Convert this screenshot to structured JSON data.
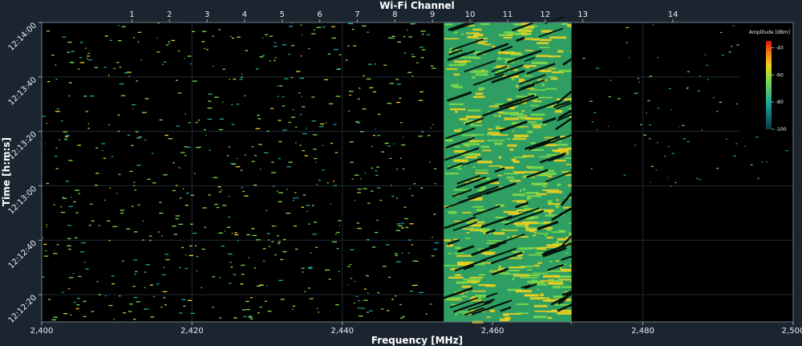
{
  "chart_data": {
    "type": "heatmap",
    "title": "Wi-Fi Channel",
    "xlabel": "Frequency [MHz]",
    "ylabel": "Time [h:m:s]",
    "xlim": [
      2400,
      2500
    ],
    "x_ticks": [
      {
        "value": 2400,
        "label": "2,400"
      },
      {
        "value": 2420,
        "label": "2,420"
      },
      {
        "value": 2440,
        "label": "2,440"
      },
      {
        "value": 2460,
        "label": "2,460"
      },
      {
        "value": 2480,
        "label": "2,480"
      },
      {
        "value": 2500,
        "label": "2,500"
      }
    ],
    "channel_ticks": [
      {
        "channel": "1",
        "freq": 2412
      },
      {
        "channel": "2",
        "freq": 2417
      },
      {
        "channel": "3",
        "freq": 2422
      },
      {
        "channel": "4",
        "freq": 2427
      },
      {
        "channel": "5",
        "freq": 2432
      },
      {
        "channel": "6",
        "freq": 2437
      },
      {
        "channel": "7",
        "freq": 2442
      },
      {
        "channel": "8",
        "freq": 2447
      },
      {
        "channel": "9",
        "freq": 2452
      },
      {
        "channel": "10",
        "freq": 2457
      },
      {
        "channel": "11",
        "freq": 2462
      },
      {
        "channel": "12",
        "freq": 2467
      },
      {
        "channel": "13",
        "freq": 2472
      },
      {
        "channel": "14",
        "freq": 2484
      }
    ],
    "y_ticks": [
      "12:14:00",
      "12:13:40",
      "12:13:20",
      "12:13:00",
      "12:12:40",
      "12:12:20"
    ],
    "y_tick_seconds": [
      0,
      20,
      40,
      60,
      80,
      100
    ],
    "time_span_seconds": 110,
    "active_band_mhz": [
      2453.5,
      2470.5
    ],
    "colorbar": {
      "title": "Amplitude [dBm]",
      "ticks": [
        "-40",
        "-60",
        "-80",
        "-100"
      ],
      "range": [
        -100,
        -35
      ],
      "colors": [
        "#0b3a44",
        "#1aa89a",
        "#7dd84a",
        "#f0d020",
        "#f07a10",
        "#e01010"
      ]
    },
    "grid": true
  }
}
